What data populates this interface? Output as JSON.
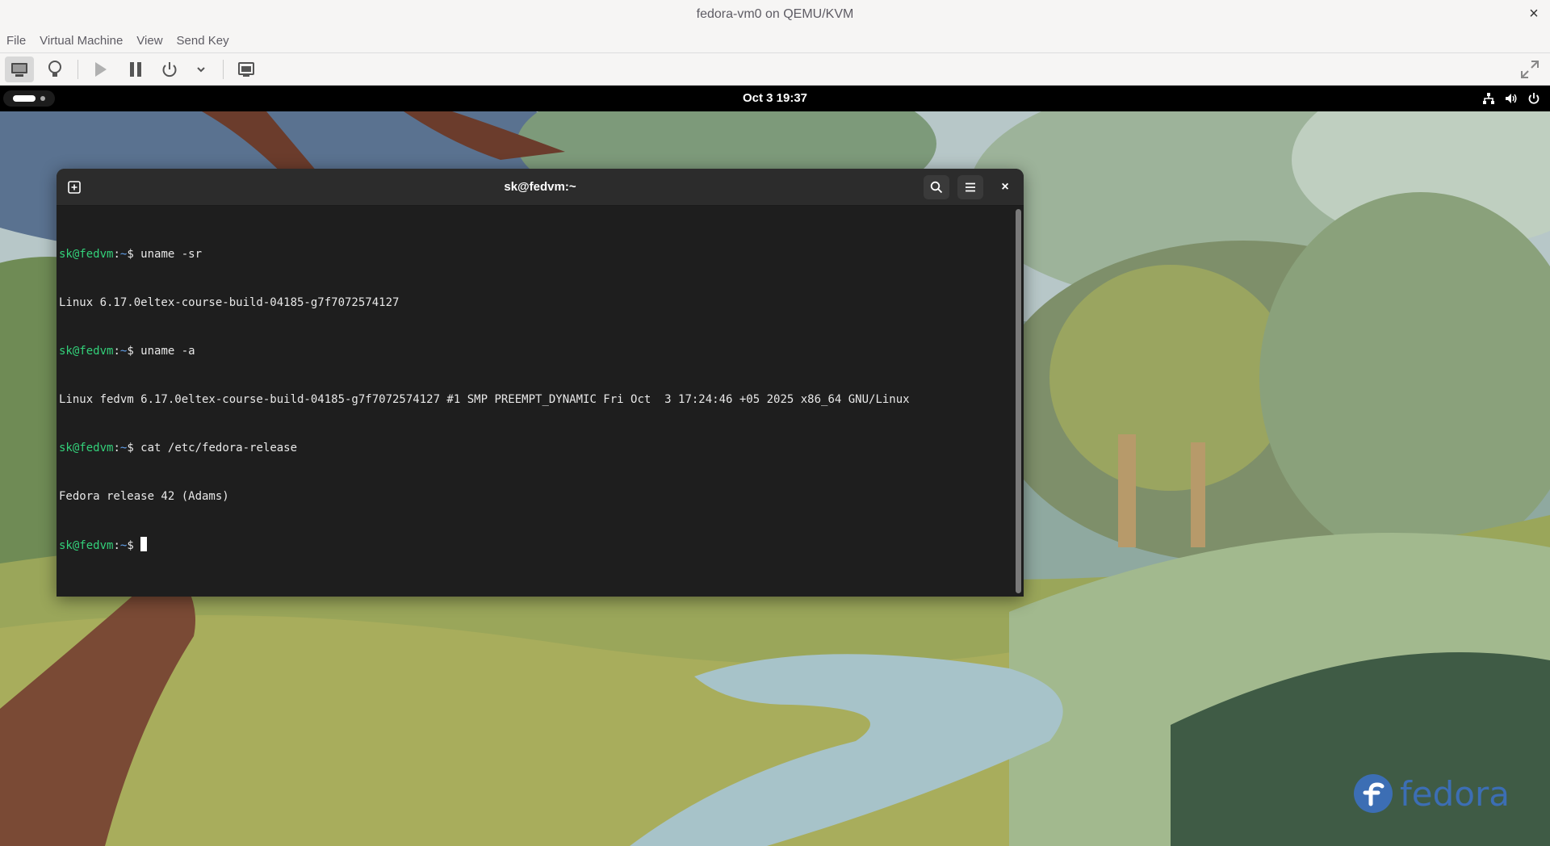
{
  "window": {
    "title": "fedora-vm0 on QEMU/KVM",
    "close_symbol": "×"
  },
  "menubar": {
    "items": [
      "File",
      "Virtual Machine",
      "View",
      "Send Key"
    ]
  },
  "toolbar": {
    "buttons": [
      {
        "icon": "monitor-icon",
        "active": true
      },
      {
        "icon": "lightbulb-icon"
      },
      {
        "icon": "play-icon"
      },
      {
        "icon": "pause-icon"
      },
      {
        "icon": "power-icon"
      },
      {
        "icon": "chevron-down-icon"
      },
      {
        "icon": "screenshot-icon"
      },
      {
        "icon": "fullscreen-icon"
      }
    ]
  },
  "guest": {
    "topbar": {
      "clock": "Oct 3  19:37",
      "tray_icons": [
        "network-icon",
        "volume-icon",
        "power-icon"
      ]
    },
    "terminal": {
      "title": "sk@fedvm:~",
      "close_symbol": "×",
      "prompt_user": "sk@fedvm",
      "prompt_path": "~",
      "lines": [
        {
          "type": "command",
          "command": "uname -sr"
        },
        {
          "type": "output",
          "text": "Linux 6.17.0eltex-course-build-04185-g7f7072574127"
        },
        {
          "type": "command",
          "command": "uname -a"
        },
        {
          "type": "output",
          "text": "Linux fedvm 6.17.0eltex-course-build-04185-g7f7072574127 #1 SMP PREEMPT_DYNAMIC Fri Oct  3 17:24:46 +05 2025 x86_64 GNU/Linux"
        },
        {
          "type": "command",
          "command": "cat /etc/fedora-release"
        },
        {
          "type": "output",
          "text": "Fedora release 42 (Adams)"
        },
        {
          "type": "command",
          "command": "",
          "cursor": true
        }
      ]
    },
    "wallpaper": {
      "logo_text": "fedora",
      "logo_color": "#3c6eb4"
    }
  }
}
